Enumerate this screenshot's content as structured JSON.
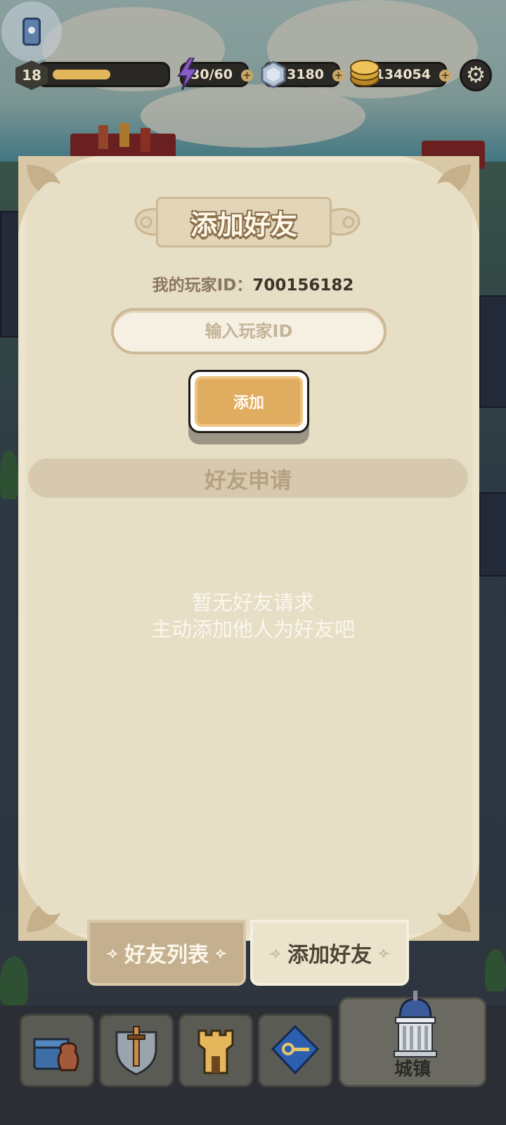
{
  "hud": {
    "level": "18",
    "xp_fraction": 0.5,
    "energy": "30/60",
    "gems": "3180",
    "coins": "134054",
    "plus_symbol": "+"
  },
  "modal": {
    "title": "添加好友",
    "my_id_label": "我的玩家ID：",
    "my_id_value": "700156182",
    "input_placeholder": "输入玩家ID",
    "add_button": "添加",
    "section_title": "好友申请",
    "empty_line1": "暂无好友请求",
    "empty_line2": "主动添加他人为好友吧"
  },
  "tabs": {
    "friend_list": "好友列表",
    "add_friend": "添加好友",
    "arrow_left": "⟢",
    "arrow_right": "⟣",
    "active": "add_friend"
  },
  "nav": {
    "town_label": "城镇",
    "items": [
      "chest-bag-icon",
      "sword-shield-icon",
      "castle-tower-icon",
      "key-map-icon",
      "town-hall-icon"
    ]
  },
  "colors": {
    "panel": "#e7dec6",
    "button": "#e0ac60",
    "title_outline": "#8a6f4d"
  }
}
